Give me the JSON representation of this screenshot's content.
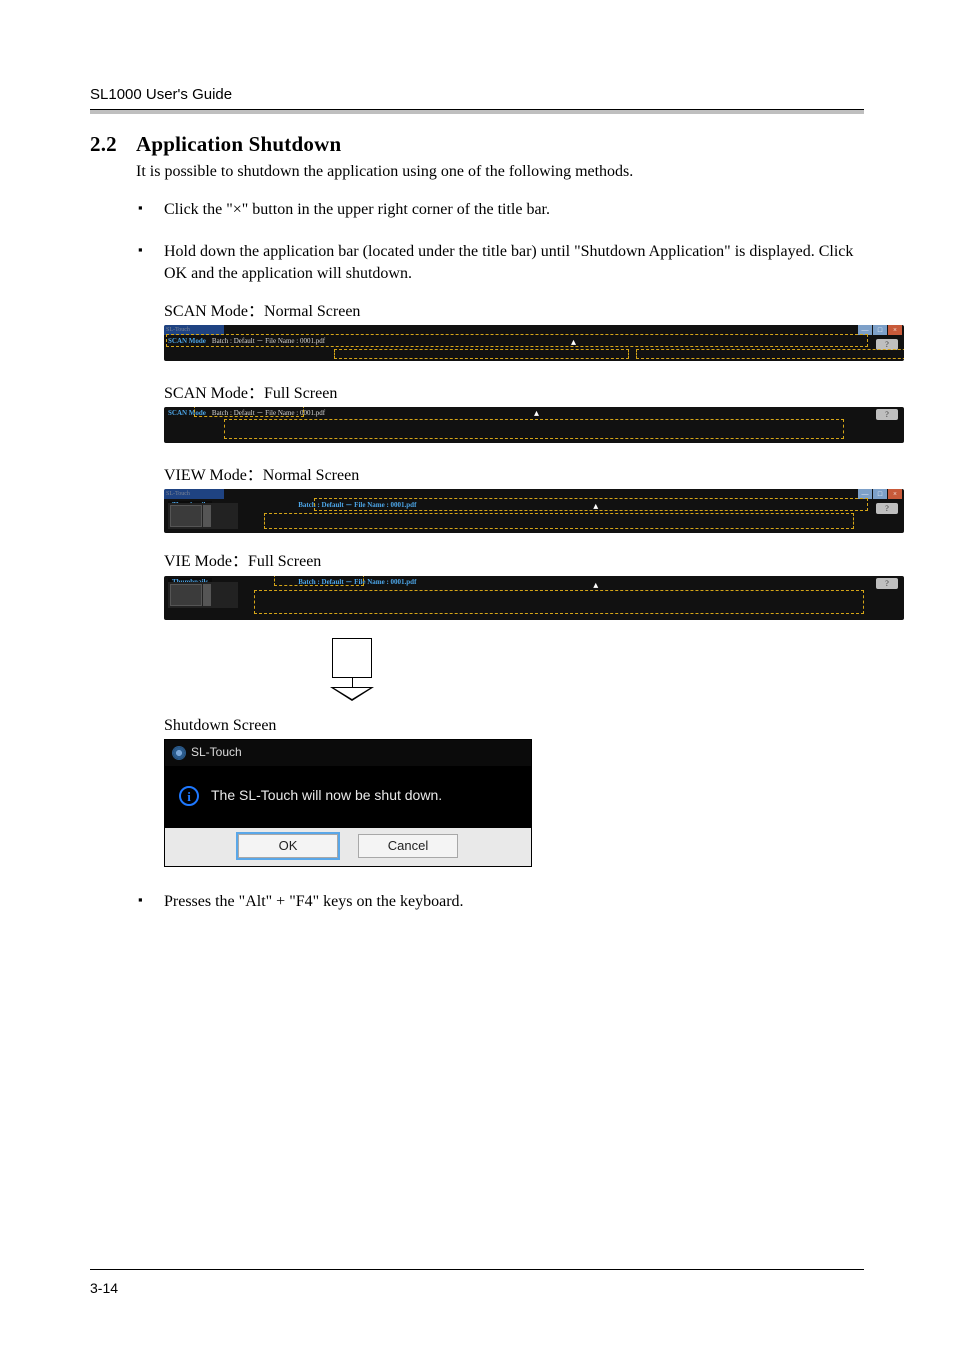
{
  "doc": {
    "header": "SL1000 User's Guide",
    "page_number": "3-14"
  },
  "section": {
    "number": "2.2",
    "title": "Application Shutdown",
    "intro": "It is possible to shutdown the application using one of the following methods.",
    "methods": [
      "Click the \"×\" button in the upper right corner of the title bar.",
      "Hold down the application bar (located under the title bar) until \"Shutdown Application\" is displayed.    Click OK and the application will shutdown.",
      "Presses the \"Alt\" + \"F4\" keys on the keyboard."
    ]
  },
  "modes": {
    "scan_normal": "SCAN Mode：Normal Screen",
    "scan_full": "SCAN Mode：Full Screen",
    "view_normal": "VIEW Mode：Normal Screen",
    "view_full": "VIE Mode：Full Screen",
    "shutdown": "Shutdown Screen"
  },
  "appbar": {
    "window_title": "SL-Touch",
    "scan_label": "SCAN Mode",
    "thumbnails_label": "Thumbnails",
    "batch_text": "Batch : Default － File Name : 0001.pdf",
    "help": "?",
    "win": {
      "min": "—",
      "max": "□",
      "close": "×"
    }
  },
  "dialog": {
    "title": "SL-Touch",
    "message": "The SL-Touch will now be shut down.",
    "ok": "OK",
    "cancel": "Cancel",
    "info_glyph": "i"
  }
}
